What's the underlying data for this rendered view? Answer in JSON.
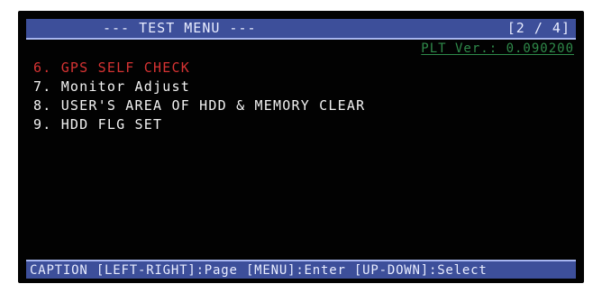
{
  "header": {
    "title": "--- TEST MENU ---",
    "page_indicator": "[2 / 4]"
  },
  "version_label": "PLT Ver.: 0.090200",
  "menu": {
    "items": [
      {
        "label": "6. GPS SELF CHECK",
        "selected": true
      },
      {
        "label": "7. Monitor Adjust",
        "selected": false
      },
      {
        "label": "8. USER'S AREA OF HDD & MEMORY CLEAR",
        "selected": false
      },
      {
        "label": "9. HDD FLG SET",
        "selected": false
      }
    ]
  },
  "footer": {
    "caption": "CAPTION [LEFT-RIGHT]:Page [MENU]:Enter [UP-DOWN]:Select"
  },
  "colors": {
    "background": "#020202",
    "bar": "#3d4f9a",
    "selected": "#d63333",
    "version": "#2f8a4a",
    "text": "#f2f2f2"
  }
}
